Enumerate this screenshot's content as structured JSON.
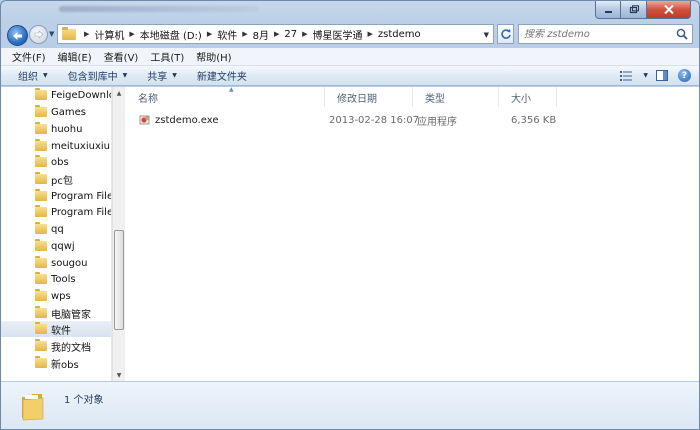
{
  "address": {
    "crumbs": [
      "计算机",
      "本地磁盘 (D:)",
      "软件",
      "8月",
      "27",
      "博星医学通",
      "zstdemo"
    ]
  },
  "search": {
    "placeholder": "搜索 zstdemo"
  },
  "menu": [
    "文件(F)",
    "编辑(E)",
    "查看(V)",
    "工具(T)",
    "帮助(H)"
  ],
  "toolbar": {
    "organize": "组织",
    "include_library": "包含到库中",
    "share": "共享",
    "new_folder": "新建文件夹"
  },
  "nav_tree": [
    "FeigeDownloa",
    "Games",
    "huohu",
    "meituxiuxiu",
    "obs",
    "pc包",
    "Program Files",
    "Program Files",
    "qq",
    "qqwj",
    "sougou",
    "Tools",
    "wps",
    "电脑管家",
    "软件",
    "我的文档",
    "新obs"
  ],
  "nav_selected": "软件",
  "columns": [
    "名称",
    "修改日期",
    "类型",
    "大小"
  ],
  "files": [
    {
      "name": "zstdemo.exe",
      "modified": "2013-02-28 16:07",
      "type": "应用程序",
      "size": "6,356 KB"
    }
  ],
  "status": {
    "count": "1 个对象"
  },
  "colors": {
    "frame": "#b9cfe6",
    "toolbar": "#d3e1f1",
    "selection": "#d9e3ef",
    "header_text": "#4c607a",
    "folder": "#e5b646"
  }
}
